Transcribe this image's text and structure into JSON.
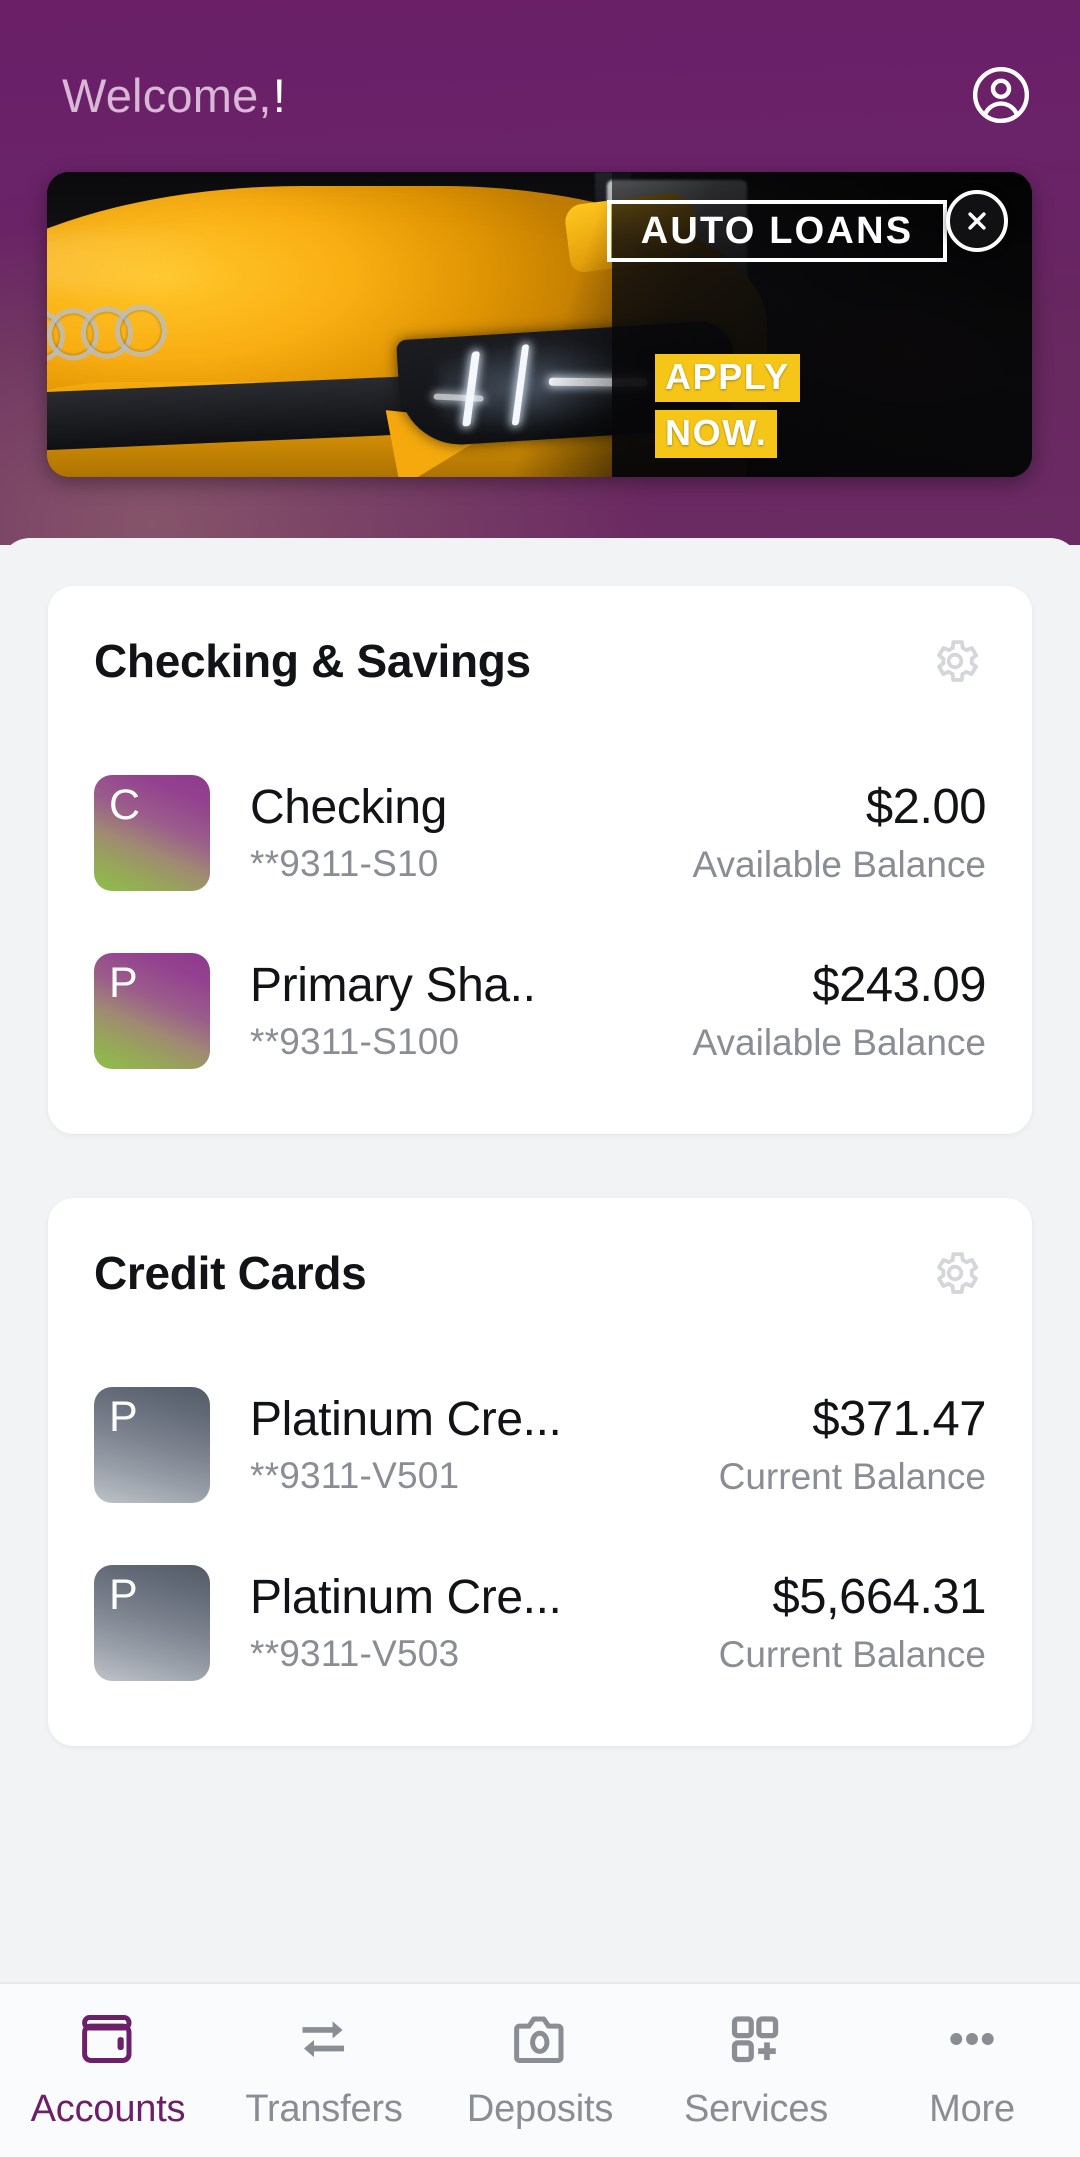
{
  "header": {
    "greeting": "Welcome,",
    "exclamation": "!",
    "profile_icon": "account-circle-icon",
    "gradient_top": "#6a1f67",
    "gradient_bottom": "#6b2a63"
  },
  "promo_banner": {
    "headline": "AUTO LOANS",
    "cta_line1": "APPLY",
    "cta_line2": "NOW.",
    "close_icon": "close-icon",
    "image_subject": "yellow-sports-car",
    "highlight_color": "#f5c518"
  },
  "sections": [
    {
      "id": "checking-savings",
      "title": "Checking & Savings",
      "settings_icon": "gear-icon",
      "tile_style": "green-purple",
      "accounts": [
        {
          "initial": "C",
          "name": "Checking",
          "mask": "**9311-S10",
          "amount": "$2.00",
          "balance_label": "Available Balance"
        },
        {
          "initial": "P",
          "name": "Primary Sha..",
          "mask": "**9311-S100",
          "amount": "$243.09",
          "balance_label": "Available Balance"
        }
      ]
    },
    {
      "id": "credit-cards",
      "title": "Credit Cards",
      "settings_icon": "gear-icon",
      "tile_style": "gray-silver",
      "accounts": [
        {
          "initial": "P",
          "name": "Platinum Cre...",
          "mask": "**9311-V501",
          "amount": "$371.47",
          "balance_label": "Current Balance"
        },
        {
          "initial": "P",
          "name": "Platinum Cre...",
          "mask": "**9311-V503",
          "amount": "$5,664.31",
          "balance_label": "Current Balance"
        }
      ]
    }
  ],
  "bottom_nav": {
    "active_color": "#6b2069",
    "inactive_color": "#8b8d94",
    "items": [
      {
        "label": "Accounts",
        "icon": "wallet-icon",
        "active": true
      },
      {
        "label": "Transfers",
        "icon": "transfer-arrows-icon",
        "active": false
      },
      {
        "label": "Deposits",
        "icon": "camera-icon",
        "active": false
      },
      {
        "label": "Services",
        "icon": "grid-plus-icon",
        "active": false
      },
      {
        "label": "More",
        "icon": "ellipsis-icon",
        "active": false
      }
    ]
  }
}
